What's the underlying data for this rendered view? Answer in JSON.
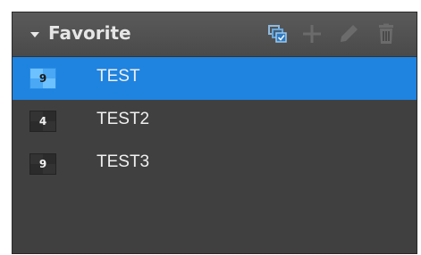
{
  "header": {
    "title": "Favorite",
    "tools": [
      {
        "name": "copy-to-all-icon"
      },
      {
        "name": "add-icon"
      },
      {
        "name": "edit-icon"
      },
      {
        "name": "delete-icon"
      }
    ]
  },
  "favorites": [
    {
      "badge": "9",
      "label": "TEST",
      "selected": true
    },
    {
      "badge": "4",
      "label": "TEST2",
      "selected": false
    },
    {
      "badge": "9",
      "label": "TEST3",
      "selected": false
    }
  ],
  "colors": {
    "panel_bg": "#404040",
    "header_bg": "#505050",
    "selection": "#1f83e0",
    "icon_accent": "#6aa6d8",
    "icon_disabled": "#6b6b6b"
  }
}
